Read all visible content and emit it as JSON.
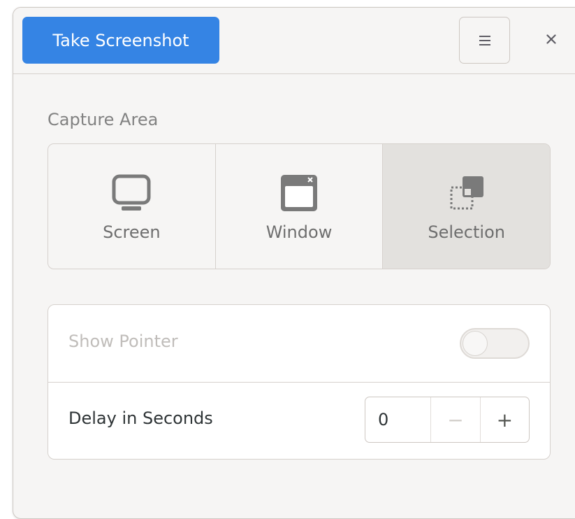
{
  "header": {
    "take_screenshot_label": "Take Screenshot",
    "menu_icon": "hamburger-menu-icon",
    "close_icon": "close-icon",
    "close_glyph": "×"
  },
  "capture_area": {
    "label": "Capture Area",
    "options": [
      {
        "label": "Screen",
        "icon": "monitor-icon",
        "selected": false
      },
      {
        "label": "Window",
        "icon": "window-icon",
        "selected": false
      },
      {
        "label": "Selection",
        "icon": "selection-icon",
        "selected": true
      }
    ]
  },
  "options": {
    "show_pointer": {
      "label": "Show Pointer",
      "enabled": false,
      "sensitive": false
    },
    "delay": {
      "label": "Delay in Seconds",
      "value": "0",
      "decrement": "−",
      "increment": "+"
    }
  },
  "colors": {
    "accent": "#3584e4",
    "window_bg": "#f6f5f4",
    "selected_bg": "#e3e1de",
    "text_dim": "#c0bdba",
    "icon_gray": "#7a7a7a"
  }
}
